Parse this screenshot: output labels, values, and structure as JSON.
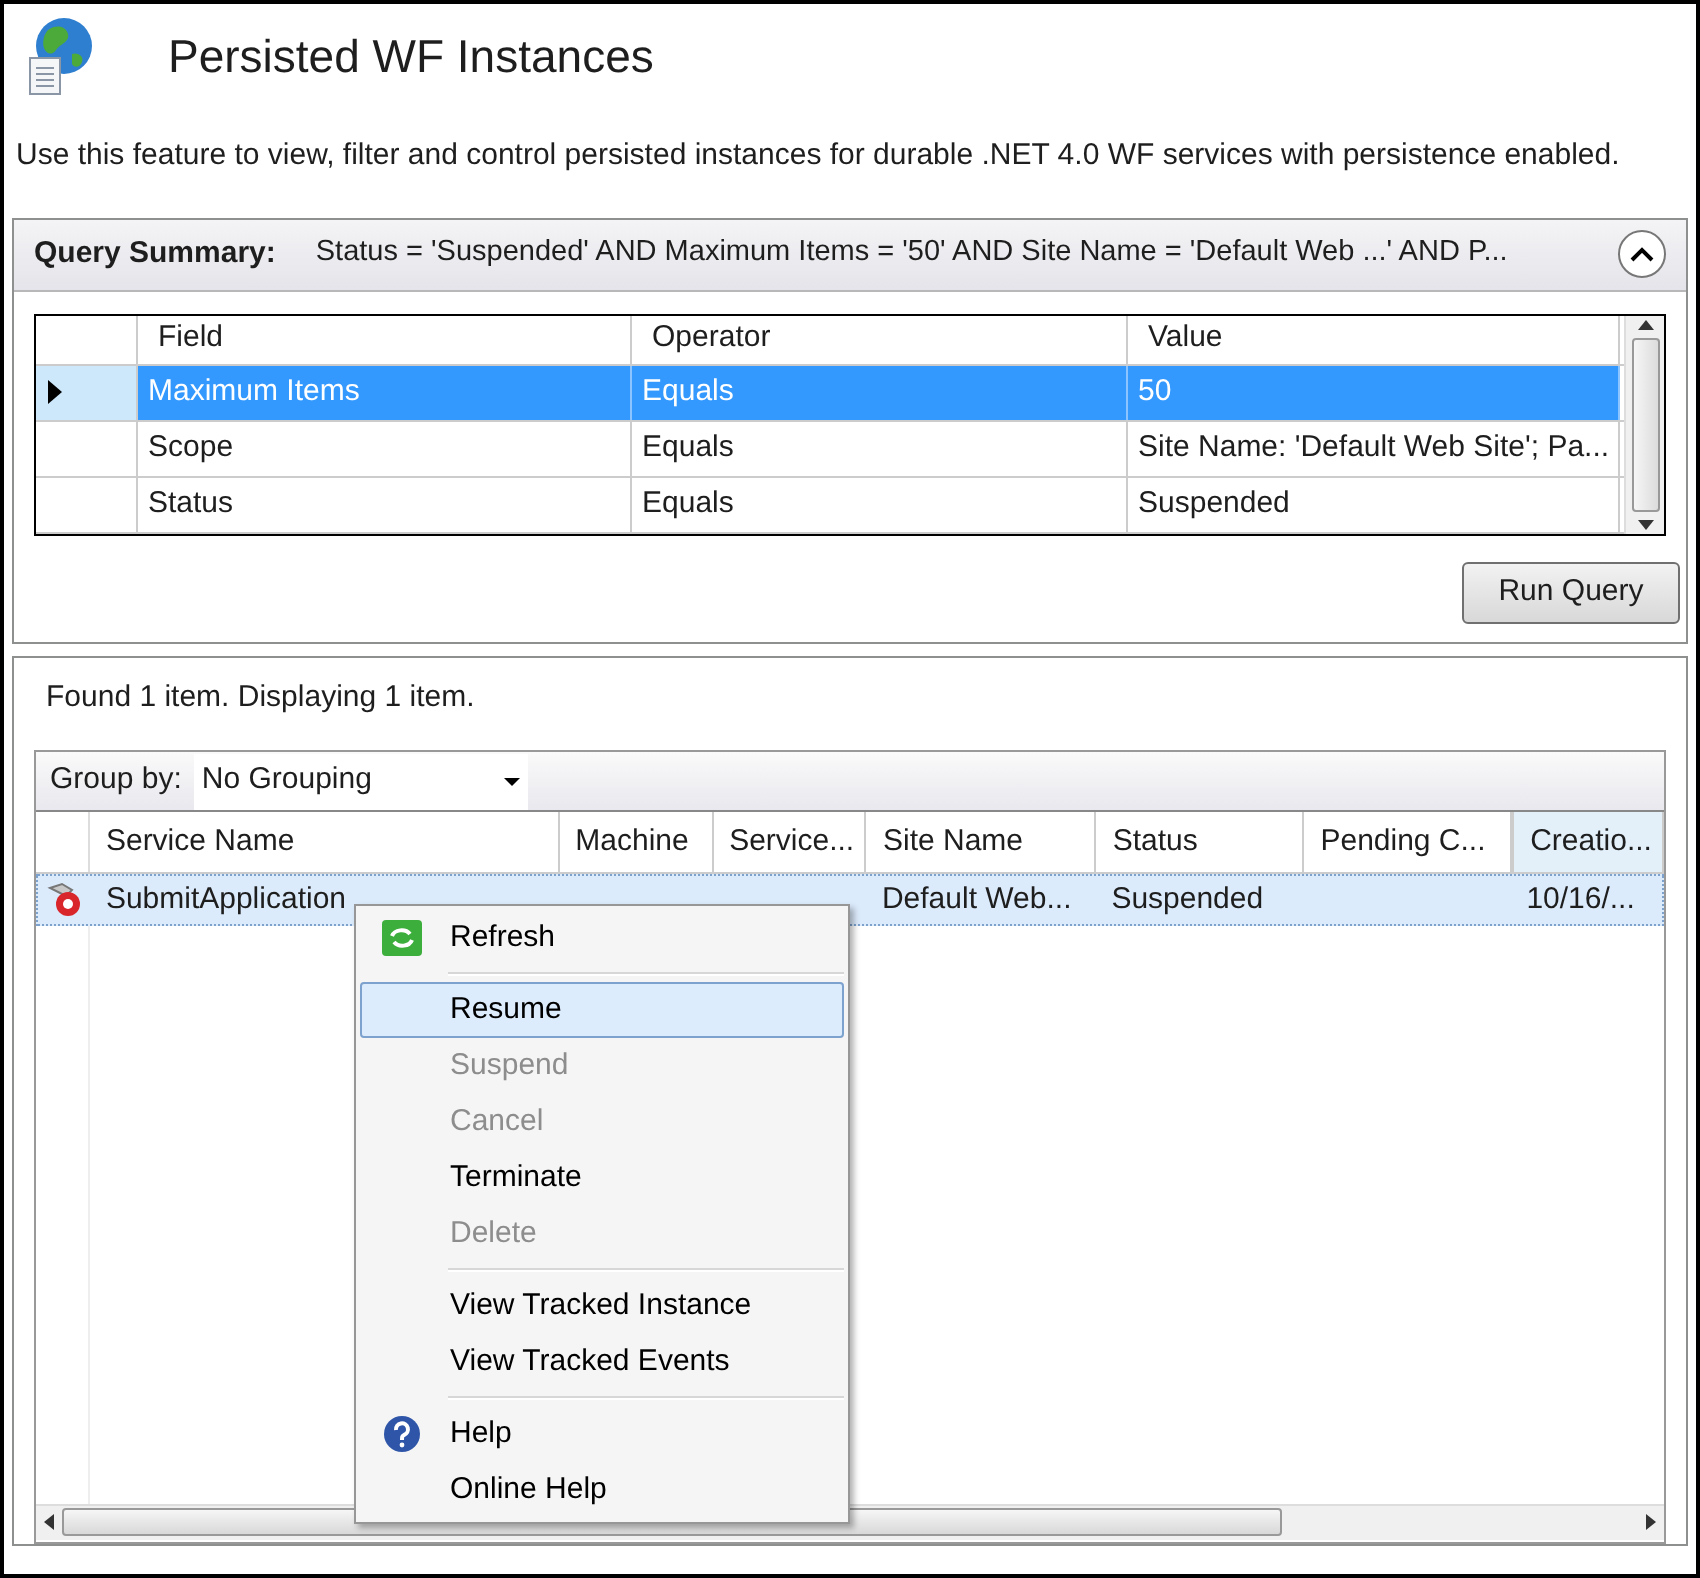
{
  "header": {
    "title": "Persisted WF Instances",
    "description": "Use this feature to view, filter and control persisted instances for durable .NET 4.0 WF services with persistence enabled."
  },
  "query_summary": {
    "label": "Query Summary:",
    "text": "Status = 'Suspended' AND Maximum Items = '50' AND Site Name = 'Default Web ...' AND P...",
    "expanded": true
  },
  "query_grid": {
    "columns": [
      "Field",
      "Operator",
      "Value"
    ],
    "rows": [
      {
        "cells": [
          "Maximum Items",
          "Equals",
          "50"
        ],
        "selected": true
      },
      {
        "cells": [
          "Scope",
          "Equals",
          "Site Name: 'Default Web Site'; Pa..."
        ],
        "selected": false
      },
      {
        "cells": [
          "Status",
          "Equals",
          "Suspended"
        ],
        "selected": false
      }
    ]
  },
  "run_query_button": "Run Query",
  "results": {
    "summary": "Found 1 item. Displaying 1 item.",
    "group_by_label": "Group by:",
    "group_by_value": "No Grouping",
    "columns": [
      "Service Name",
      "Machine",
      "Service...",
      "Site Name",
      "Status",
      "Pending C...",
      "Creatio..."
    ],
    "rows": [
      {
        "cells": [
          "SubmitApplication",
          null,
          null,
          "Default Web...",
          "Suspended",
          null,
          "10/16/..."
        ],
        "selected": true
      }
    ]
  },
  "context_menu": {
    "groups": [
      [
        {
          "label": "Refresh",
          "disabled": false,
          "selected": false
        }
      ],
      [
        {
          "label": "Resume",
          "disabled": false,
          "selected": true
        },
        {
          "label": "Suspend",
          "disabled": true,
          "selected": false
        },
        {
          "label": "Cancel",
          "disabled": true,
          "selected": false
        },
        {
          "label": "Terminate",
          "disabled": false,
          "selected": false
        },
        {
          "label": "Delete",
          "disabled": true,
          "selected": false
        }
      ],
      [
        {
          "label": "View Tracked Instance",
          "disabled": false,
          "selected": false
        },
        {
          "label": "View Tracked Events",
          "disabled": false,
          "selected": false
        }
      ],
      [
        {
          "label": "Help",
          "disabled": false,
          "selected": false
        },
        {
          "label": "Online Help",
          "disabled": false,
          "selected": false
        }
      ]
    ]
  }
}
